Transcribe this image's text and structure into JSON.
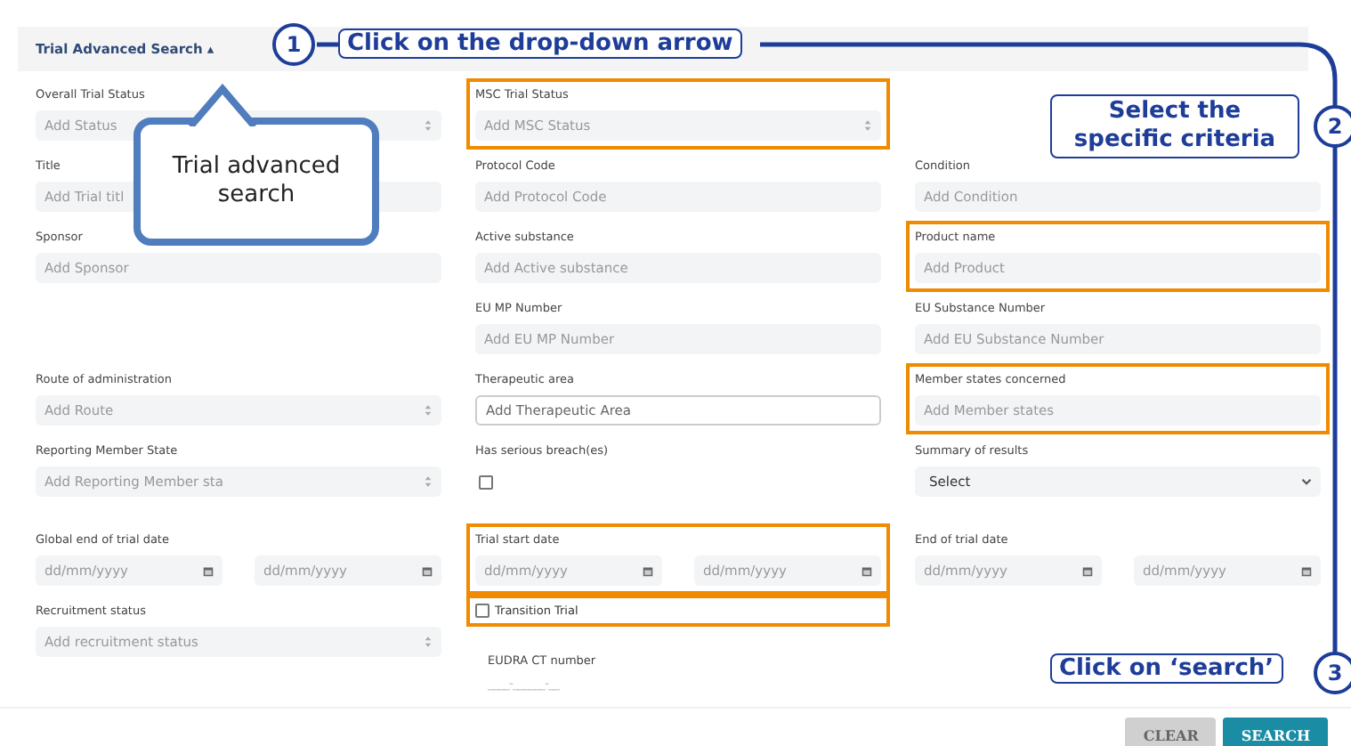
{
  "header": {
    "title": "Trial Advanced Search",
    "caret": "▴"
  },
  "rows": [
    [
      {
        "label": "Overall Trial Status",
        "kind": "multiselect",
        "placeholder": "Add Status",
        "highlighted": false
      },
      {
        "label": "MSC Trial Status",
        "kind": "multiselect",
        "placeholder": "Add MSC Status",
        "highlighted": true
      },
      null
    ],
    [
      {
        "label": "Title",
        "kind": "text",
        "placeholder": "Add Trial titl",
        "highlighted": false
      },
      {
        "label": "Protocol Code",
        "kind": "text",
        "placeholder": "Add Protocol Code",
        "highlighted": false
      },
      {
        "label": "Condition",
        "kind": "text",
        "placeholder": "Add Condition",
        "highlighted": false
      }
    ],
    [
      {
        "label": "Sponsor",
        "kind": "text",
        "placeholder": "Add Sponsor",
        "highlighted": false
      },
      {
        "label": "Active substance",
        "kind": "text",
        "placeholder": "Add Active substance",
        "highlighted": false
      },
      {
        "label": "Product name",
        "kind": "text",
        "placeholder": "Add Product",
        "highlighted": true
      }
    ],
    [
      null,
      {
        "label": "EU MP Number",
        "kind": "text",
        "placeholder": "Add EU MP Number",
        "highlighted": false
      },
      {
        "label": "EU Substance Number",
        "kind": "text",
        "placeholder": "Add EU Substance Number",
        "highlighted": false
      }
    ],
    [
      {
        "label": "Route of administration",
        "kind": "multiselect",
        "placeholder": "Add Route",
        "highlighted": false
      },
      {
        "label": "Therapeutic area",
        "kind": "outlined",
        "placeholder": "Add Therapeutic Area",
        "highlighted": false
      },
      {
        "label": "Member states concerned",
        "kind": "text",
        "placeholder": "Add Member states",
        "highlighted": true
      }
    ],
    [
      {
        "label": "Reporting Member State",
        "kind": "multiselect",
        "placeholder": "Add Reporting Member sta",
        "highlighted": false
      },
      {
        "label": "Has serious breach(es)",
        "kind": "checkbox",
        "checked": false,
        "highlighted": false
      },
      {
        "label": "Summary of results",
        "kind": "dropdown",
        "value": "Select",
        "highlighted": false
      }
    ],
    [
      {
        "label": "Global end of trial date",
        "kind": "dates",
        "placeholders": [
          "dd/mm/yyyy",
          "dd/mm/yyyy"
        ],
        "highlighted": false
      },
      {
        "label": "Trial start date",
        "kind": "dates",
        "placeholders": [
          "dd/mm/yyyy",
          "dd/mm/yyyy"
        ],
        "highlighted": true
      },
      {
        "label": "End of trial date",
        "kind": "dates",
        "placeholders": [
          "dd/mm/yyyy",
          "dd/mm/yyyy"
        ],
        "highlighted": false
      }
    ],
    [
      {
        "label": "Recruitment status",
        "kind": "multiselect",
        "placeholder": "Add recruitment status",
        "highlighted": false
      },
      {
        "kind": "transition",
        "check_label": "Transition Trial",
        "checked": false,
        "highlighted": true,
        "sub_label": "EUDRA CT number",
        "mask": "____-______-__"
      },
      null
    ]
  ],
  "buttons": [
    {
      "label": "CLEAR",
      "kind": "secondary"
    },
    {
      "label": "SEARCH",
      "kind": "primary"
    }
  ],
  "annotations": {
    "callout": "Trial advanced search",
    "steps": [
      {
        "number": "1",
        "text": "Click on the drop-down arrow"
      },
      {
        "number": "2",
        "text": "Select the specific criteria"
      },
      {
        "number": "3",
        "text": "Click on ‘search’"
      }
    ]
  }
}
